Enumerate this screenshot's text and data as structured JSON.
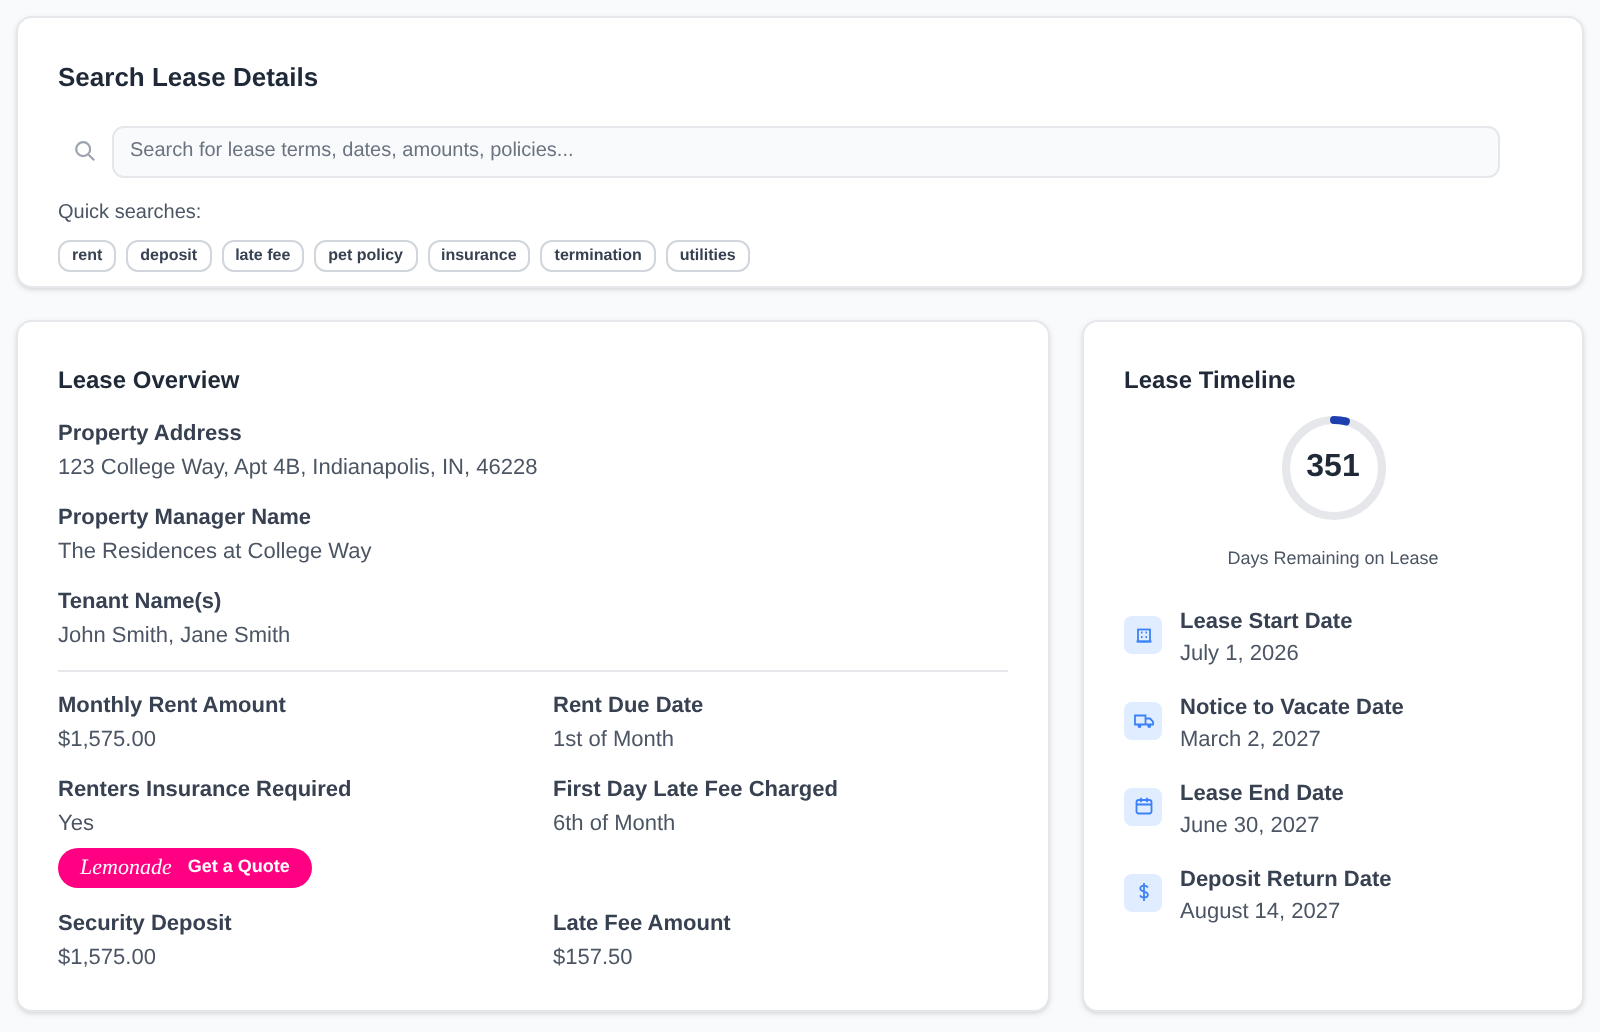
{
  "search": {
    "title": "Search Lease Details",
    "placeholder": "Search for lease terms, dates, amounts, policies...",
    "quick_label": "Quick searches:",
    "quick": [
      "rent",
      "deposit",
      "late fee",
      "pet policy",
      "insurance",
      "termination",
      "utilities"
    ]
  },
  "overview": {
    "title": "Lease Overview",
    "top_fields": [
      {
        "label": "Property Address",
        "value": "123 College Way, Apt 4B, Indianapolis, IN, 46228"
      },
      {
        "label": "Property Manager Name",
        "value": "The Residences at College Way"
      },
      {
        "label": "Tenant Name(s)",
        "value": "John Smith, Jane Smith"
      }
    ],
    "grid_fields": [
      {
        "label": "Monthly Rent Amount",
        "value": "$1,575.00"
      },
      {
        "label": "Rent Due Date",
        "value": "1st of Month"
      },
      {
        "label": "Renters Insurance Required",
        "value": "Yes",
        "quote": {
          "brand": "Lemonade",
          "label": "Get a Quote"
        }
      },
      {
        "label": "First Day Late Fee Charged",
        "value": "6th of Month"
      },
      {
        "label": "Security Deposit",
        "value": "$1,575.00"
      },
      {
        "label": "Late Fee Amount",
        "value": "$157.50"
      }
    ]
  },
  "timeline": {
    "title": "Lease Timeline",
    "days": "351",
    "days_label": "Days Remaining on Lease",
    "level": 0.04,
    "events": [
      {
        "kind": "start",
        "label": "Lease Start Date",
        "date": "July 1, 2026"
      },
      {
        "kind": "notice",
        "label": "Notice to Vacate Date",
        "date": "March 2, 2027"
      },
      {
        "kind": "end",
        "label": "Lease End Date",
        "date": "June 30, 2027"
      },
      {
        "kind": "deposit",
        "label": "Deposit Return Date",
        "date": "August 14, 2027"
      }
    ]
  }
}
